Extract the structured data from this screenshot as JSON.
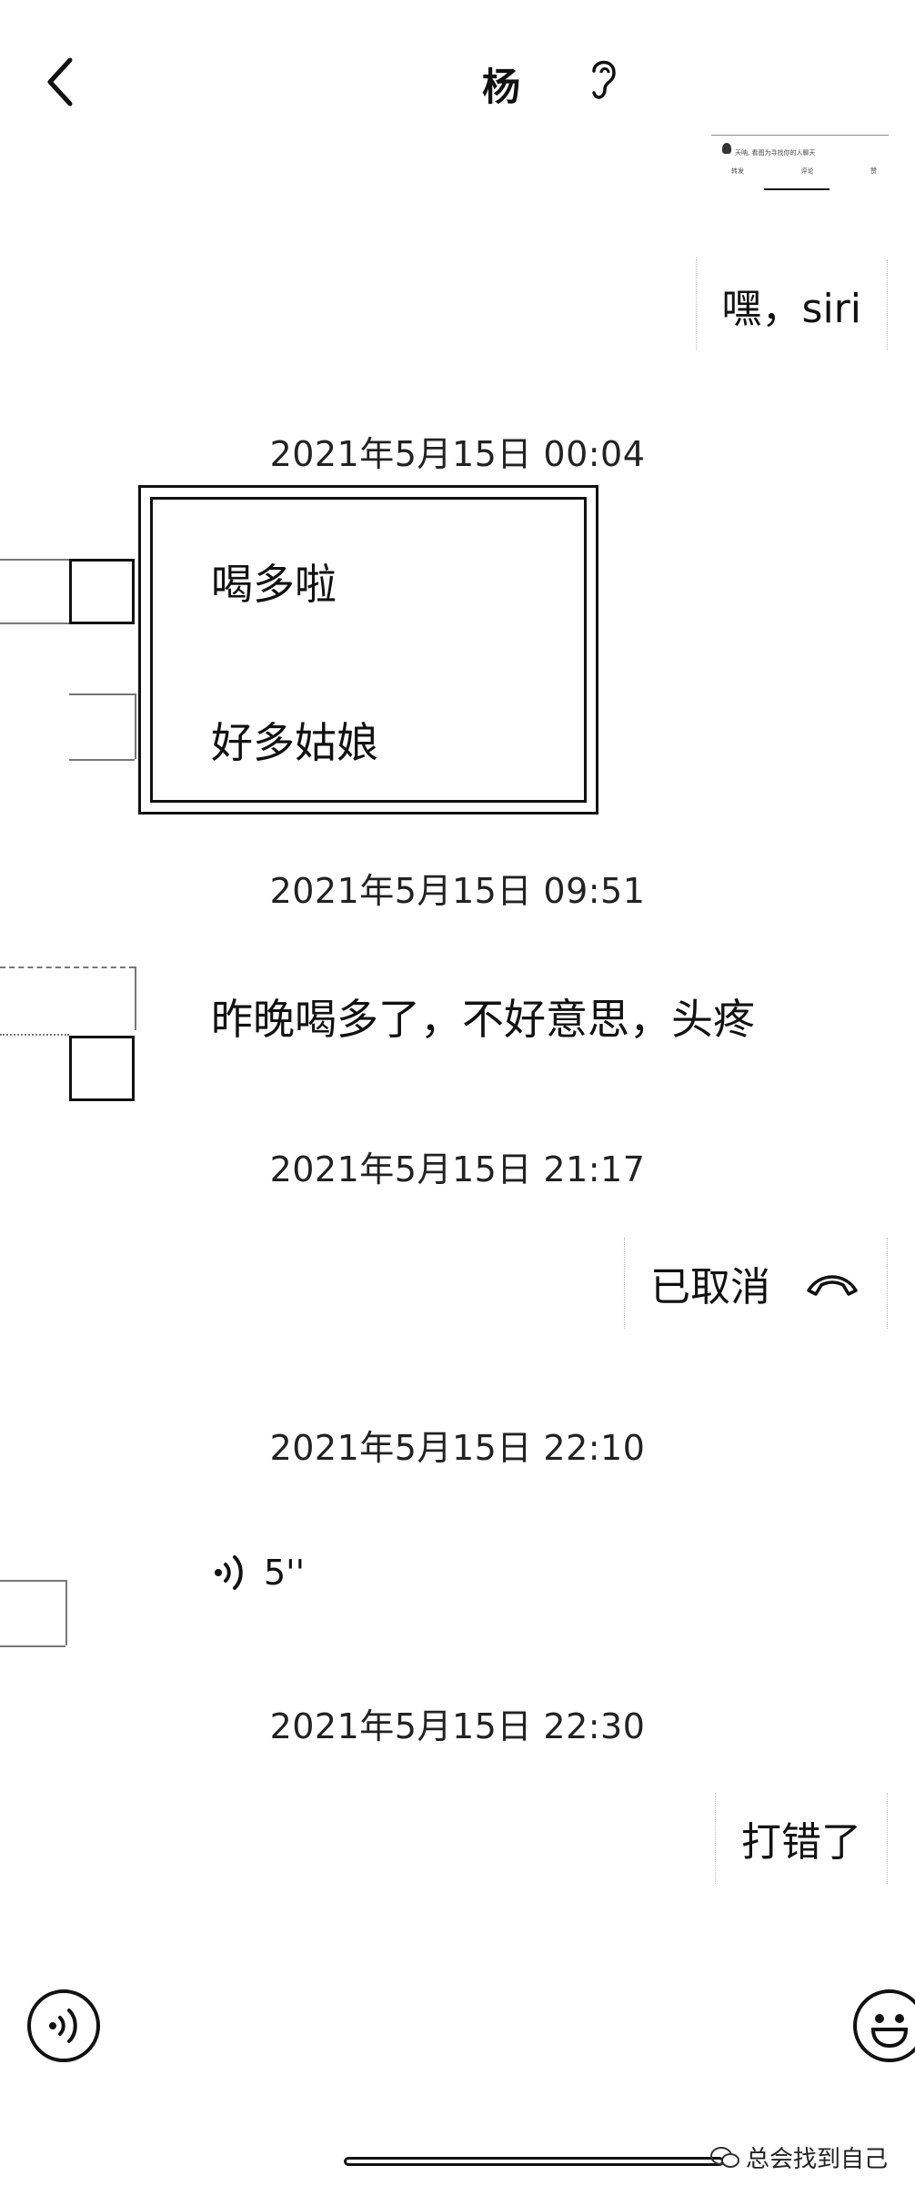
{
  "header": {
    "title": "杨",
    "back_icon": "chevron-left-icon",
    "ear_icon": "ear-icon"
  },
  "quote_card": {
    "text": "天呐, 看图为寻找你的人聊天",
    "actions": [
      "转发",
      "评论",
      "赞"
    ]
  },
  "messages": [
    {
      "dir": "out",
      "text": "嘿，siri"
    },
    {
      "time": "2021年5月15日 00:04"
    },
    {
      "dir": "in",
      "texts": [
        "喝多啦",
        "好多姑娘"
      ]
    },
    {
      "time": "2021年5月15日 09:51"
    },
    {
      "dir": "in",
      "text": "昨晚喝多了，不好意思，头疼"
    },
    {
      "time": "2021年5月15日 21:17"
    },
    {
      "dir": "out",
      "text": "已取消",
      "icon": "phone-hangup-icon"
    },
    {
      "time": "2021年5月15日 22:10"
    },
    {
      "dir": "in",
      "voice_duration": "5''"
    },
    {
      "time": "2021年5月15日 22:30"
    },
    {
      "dir": "out",
      "text": "打错了"
    }
  ],
  "bottom_bar": {
    "left_icon": "voice-input-icon",
    "right_icon": "emoji-icon"
  },
  "watermark": {
    "text": "总会找到自己"
  }
}
